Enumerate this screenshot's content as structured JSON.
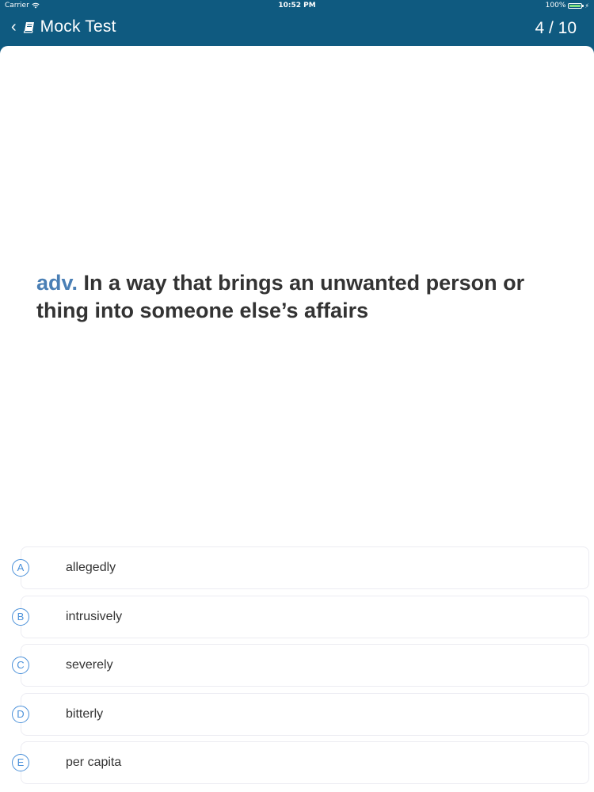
{
  "status_bar": {
    "carrier": "Carrier",
    "time": "10:52 PM",
    "battery": "100%"
  },
  "nav": {
    "back_icon": "chevron-left-icon",
    "title_icon": "book-icon",
    "title": "Mock Test",
    "progress": "4 / 10"
  },
  "question": {
    "part_of_speech": "adv.",
    "definition": "In a way that brings an unwanted person or thing into someone else’s affairs"
  },
  "answers": [
    {
      "letter": "A",
      "text": "allegedly"
    },
    {
      "letter": "B",
      "text": "intrusively"
    },
    {
      "letter": "C",
      "text": "severely"
    },
    {
      "letter": "D",
      "text": "bitterly"
    },
    {
      "letter": "E",
      "text": "per capita"
    }
  ],
  "colors": {
    "nav_background": "#0f5a80",
    "accent": "#4a90d9",
    "part_of_speech": "#4a7fb5",
    "text": "#333333"
  }
}
